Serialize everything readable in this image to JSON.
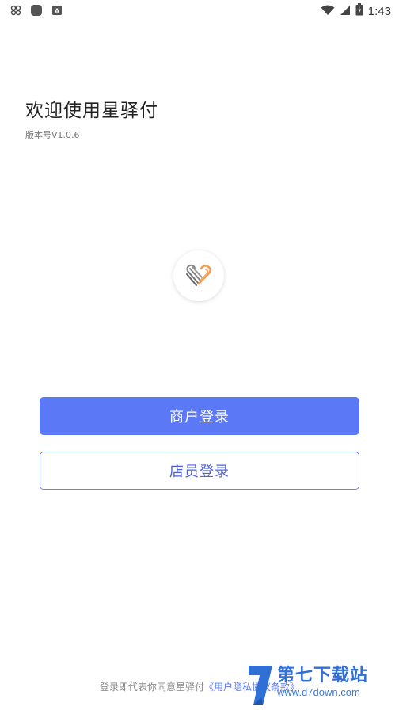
{
  "status_bar": {
    "time": "1:43",
    "left_icons": [
      "cluster-icon",
      "rounded-square-icon",
      "a-badge-icon"
    ],
    "right_icons": [
      "wifi-icon",
      "signal-icon",
      "battery-icon"
    ],
    "a_badge": "A"
  },
  "welcome": {
    "title": "欢迎使用星驿付",
    "version": "版本号V1.0.6"
  },
  "logo": {
    "icon": "heart-logo-icon",
    "accent": "#f39a4a"
  },
  "buttons": {
    "merchant_login": "商户登录",
    "staff_login": "店员登录"
  },
  "footer": {
    "text": "登录即代表你同意星驿付",
    "link": "《用户隐私协议条款》"
  },
  "watermark": {
    "main": "第七下载站",
    "sub": "www.d7down.com"
  },
  "colors": {
    "primary": "#5b78f6",
    "outline": "#6b82f0"
  }
}
